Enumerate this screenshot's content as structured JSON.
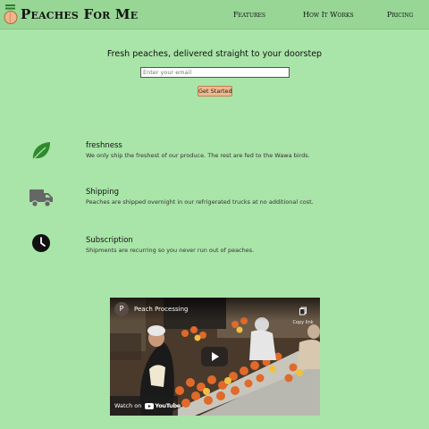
{
  "nav": {
    "brand": "Peaches For Me",
    "links": [
      "Features",
      "How It Works",
      "Pricing"
    ]
  },
  "hero": {
    "title": "Fresh peaches, delivered straight to your doorstep",
    "email_placeholder": "Enter your email",
    "cta_label": "Get Started"
  },
  "features": [
    {
      "icon": "leaf-icon",
      "title": "freshness",
      "desc": "We only ship the freshest of our produce. The rest are fed to the Wawa birds."
    },
    {
      "icon": "truck-icon",
      "title": "Shipping",
      "desc": "Peaches are shipped overnight in our refrigerated trucks at no additional cost."
    },
    {
      "icon": "clock-icon",
      "title": "Subscription",
      "desc": "Shipments are recurring so you never run out of peaches."
    }
  ],
  "video": {
    "channel_initial": "P",
    "title": "Peach Processing",
    "copy_label": "Copy link",
    "watch_label": "Watch on",
    "youtube_label": "YouTube"
  },
  "colors": {
    "page_background": "#a9e4a8",
    "navbar": "#97d694",
    "cta_button": "#f0b990",
    "leaf_icon": "#2e8b2e",
    "truck_icon": "#666666"
  }
}
